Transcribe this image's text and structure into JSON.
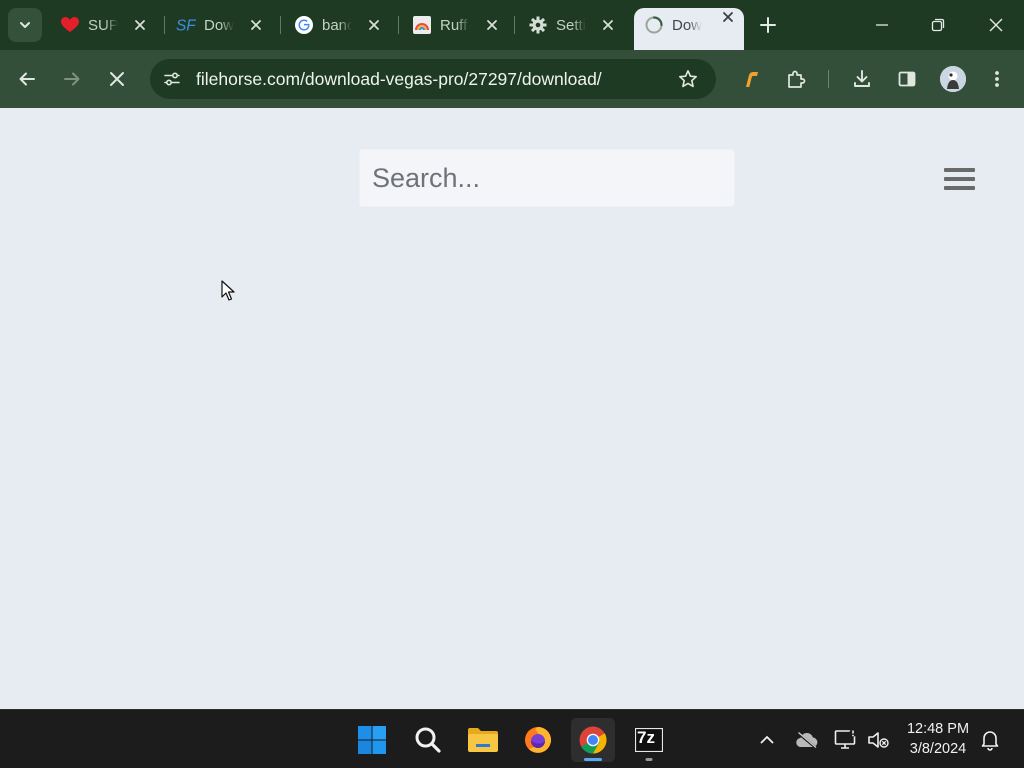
{
  "browser": {
    "tabs": [
      {
        "title": "SUPI",
        "favicon": "heart-icon",
        "active": false
      },
      {
        "title": "Dow",
        "favicon": "sourceforge-icon",
        "active": false
      },
      {
        "title": "banc",
        "favicon": "google-icon",
        "active": false
      },
      {
        "title": "Ruff",
        "favicon": "rainbow-icon",
        "active": false
      },
      {
        "title": "Setti",
        "favicon": "gear-icon",
        "active": false
      },
      {
        "title": "Dow",
        "favicon": "loading-icon",
        "active": true
      }
    ],
    "url": "filehorse.com/download-vegas-pro/27297/download/",
    "loading": true,
    "colors": {
      "frame": "#1e3a23",
      "toolbar": "#334e39",
      "page": "#e7ebf2"
    }
  },
  "page": {
    "search": {
      "placeholder": "Search...",
      "value": ""
    },
    "menu_icon": "hamburger-icon"
  },
  "taskbar": {
    "apps": [
      "start-icon",
      "search-icon",
      "file-explorer-icon",
      "firefox-icon",
      "chrome-icon",
      "7zip-icon"
    ],
    "sevenzip_label": "7z",
    "time": "12:48 PM",
    "date": "3/8/2024"
  }
}
